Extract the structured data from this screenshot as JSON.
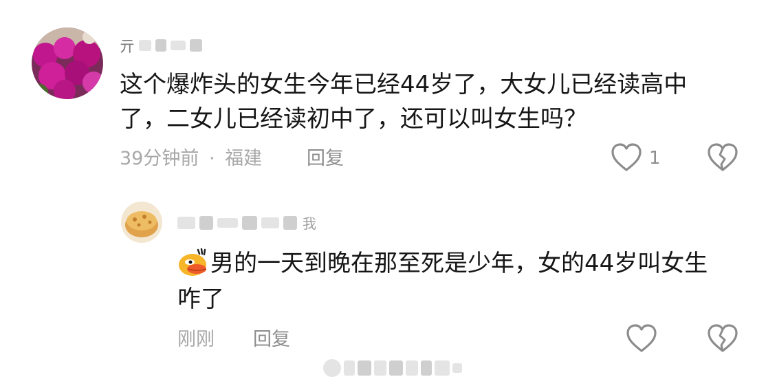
{
  "comment": {
    "username_visible": "亓",
    "lines": [
      "这个爆炸头的女生今年已经44岁了，大女儿已经读高中",
      "了，二女儿已经读初中了，还可以叫女生吗？"
    ],
    "time": "39分钟前",
    "dot": "·",
    "location": "福建",
    "reply_label": "回复",
    "like_count": "1"
  },
  "reply": {
    "author_tag": "我",
    "lines": [
      "男的一天到晚在那至死是少年，女的44岁叫女生",
      "咋了"
    ],
    "time": "刚刚",
    "reply_label": "回复"
  },
  "icons": {
    "like": "heart-outline-icon",
    "dislike": "broken-heart-icon",
    "emoji": "duck-sticker-emoji"
  },
  "colors": {
    "text": "#161616",
    "meta": "#a8a8a8",
    "icon": "#8c8c8c"
  }
}
